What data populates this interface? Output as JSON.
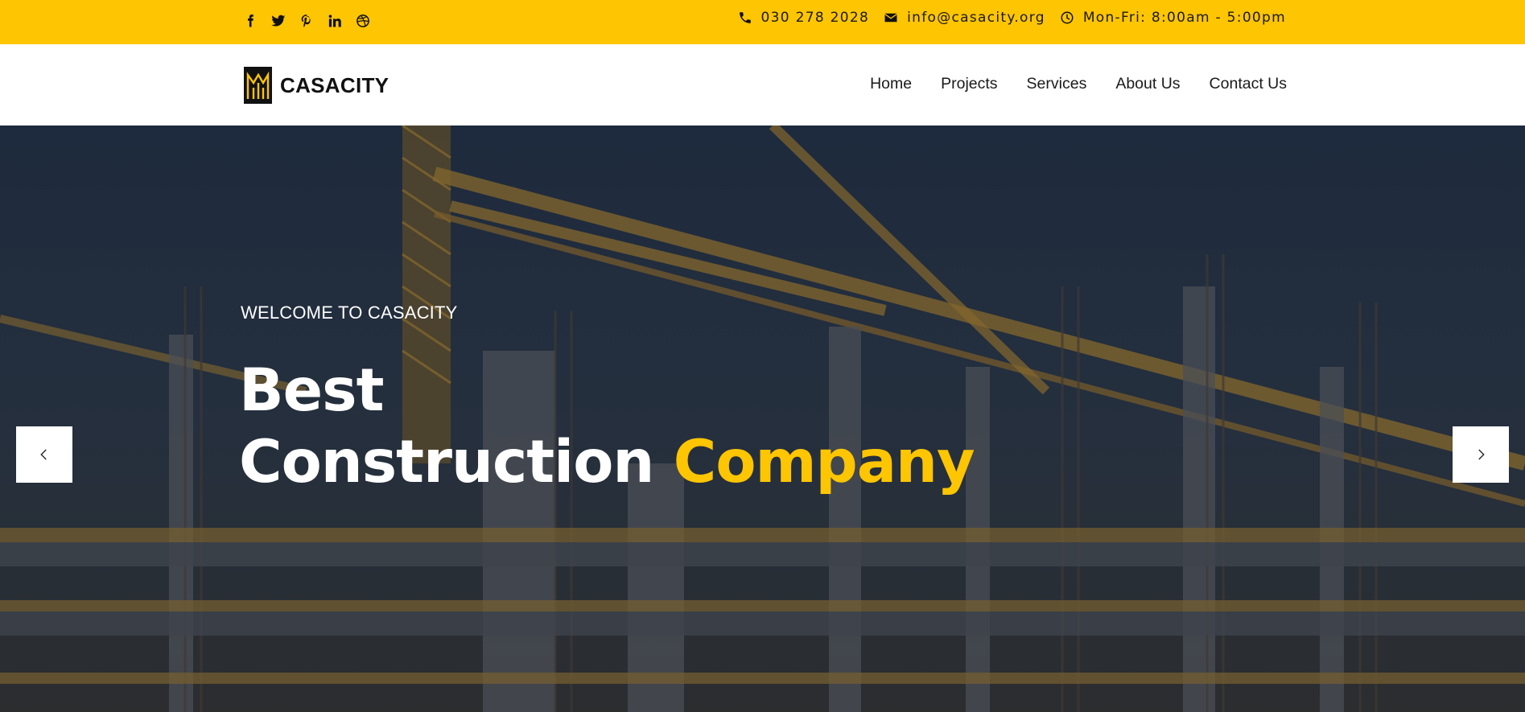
{
  "topbar": {
    "social": [
      {
        "name": "facebook-icon"
      },
      {
        "name": "twitter-icon"
      },
      {
        "name": "pinterest-icon"
      },
      {
        "name": "linkedin-icon"
      },
      {
        "name": "dribbble-icon"
      }
    ],
    "phone": "030 278 2028",
    "email": "info@casacity.org",
    "hours": "Mon-Fri: 8:00am - 5:00pm"
  },
  "header": {
    "logo_text": "CASACITY",
    "nav": [
      "Home",
      "Projects",
      "Services",
      "About Us",
      "Contact Us"
    ]
  },
  "hero": {
    "kicker": "WELCOME TO CASACITY",
    "headline_line1": "Best",
    "headline_line2": "Construction",
    "headline_accent": "Company"
  },
  "colors": {
    "accent": "#fec503",
    "topbar": "#fec503",
    "header_bg": "#ffffff",
    "hero_text": "#ffffff"
  },
  "icons": {
    "phone": "phone-icon",
    "email": "envelope-icon",
    "hours": "clock-icon",
    "prev": "chevron-left-icon",
    "next": "chevron-right-icon"
  }
}
